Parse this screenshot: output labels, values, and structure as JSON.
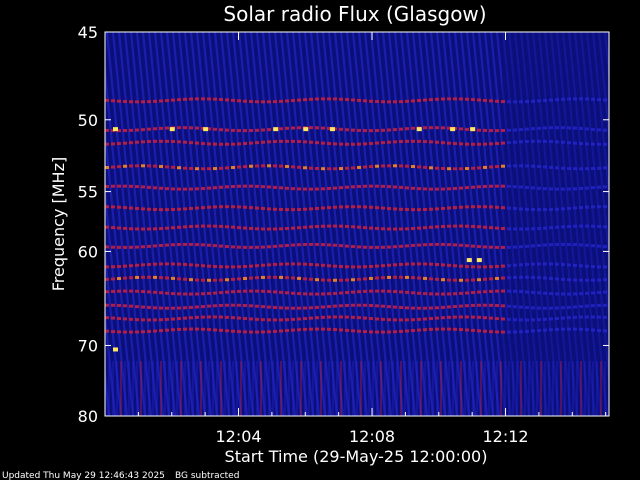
{
  "chart_data": {
    "type": "heatmap",
    "title": "Solar radio Flux (Glasgow)",
    "ylabel": "Frequency [MHz]",
    "xlabel": "Start Time (29-May-25 12:00:00)",
    "x_ticks": [
      "12:04",
      "12:08",
      "12:12"
    ],
    "x_tick_values_min": [
      4,
      8,
      12
    ],
    "xlim_min": [
      0,
      15.1
    ],
    "y_ticks": [
      "45",
      "50",
      "55",
      "60",
      "70",
      "80"
    ],
    "y_tick_values": [
      45,
      50,
      55,
      60,
      70,
      80
    ],
    "ylim": [
      45,
      80
    ],
    "y_scale": "reciprocal",
    "grid": false,
    "colors": {
      "background": "#000000",
      "low": "#0a0f7a",
      "mid": "#2a2ad8",
      "band": "#c81e3c",
      "high": "#ff8a1a",
      "peak": "#ffe860",
      "frame": "#ffffff"
    },
    "interference_bands_mhz": [
      48.8,
      50.6,
      51.5,
      53.2,
      54.7,
      56.3,
      57.9,
      59.5,
      61.3,
      62.6,
      64.0,
      65.5,
      66.8,
      68.2
    ],
    "signal_cutoff_min": 11.9
  },
  "footer": {
    "updated": "Updated Thu May 29 12:46:43 2025",
    "note": "BG subtracted"
  }
}
